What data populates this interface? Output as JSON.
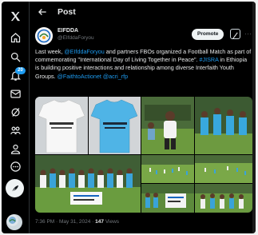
{
  "header": {
    "title": "Post"
  },
  "nav": {
    "notification_count": "20"
  },
  "post": {
    "display_name": "EIFDDA",
    "handle": "@EIfddaForyou",
    "promote_label": "Promote",
    "text_part1": "Last week, ",
    "mention1": "@EIfddaForyou",
    "text_part2": " and partners FBOs organized a Football Match as part of commemorating \"International Day of Living Together in Peace\". ",
    "hashtag": "#JISRA",
    "text_part3": " in Ethiopia is building positive interactions and relationship among diverse Interfaith Youth Groups. ",
    "mention2": "@FaithtoActionet",
    "mention3": "@acri_rfp",
    "tshirt_print": "NAAH WALTHUMMAN LIVING TOGETHER IN PEACE",
    "timestamp": "7:36 PM · May 31, 2024 · ",
    "views_count": "147",
    "views_label": " Views"
  },
  "colors": {
    "background": "#000000",
    "accent": "#1d9bf0",
    "text": "#e7e9ea",
    "muted": "#71767b"
  },
  "icons": [
    "x-logo-icon",
    "home-icon",
    "search-icon",
    "notifications-icon",
    "messages-icon",
    "grok-icon",
    "communities-icon",
    "profile-icon",
    "more-circle-icon",
    "post-feather-icon",
    "back-arrow-icon",
    "grok-analyze-icon",
    "more-icon"
  ]
}
